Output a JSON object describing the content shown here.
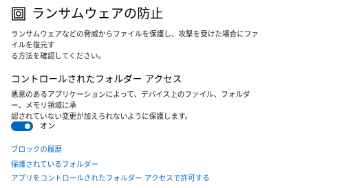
{
  "header": {
    "title": "ランサムウェアの防止",
    "icon": "ransomware-protection-icon"
  },
  "description": {
    "lines": [
      "ランサムウェアなどの脅威からファイルを保護し、攻撃を受けた場合にファイルを復元す",
      "る方法を確認してください。"
    ]
  },
  "controlled_folder_access": {
    "title": "コントロールされたフォルダー アクセス",
    "description_lines": [
      "悪意のあるアプリケーションによって、デバイス上のファイル、フォルダー、メモリ領域に承",
      "認されていない変更が加えられないように保護します。"
    ],
    "toggle": {
      "state": "on",
      "label": "オン",
      "color": "#0067c0"
    }
  },
  "links": [
    "ブロックの履歴",
    "保護されているフォルダー",
    "アプリをコントロールされたフォルダー アクセスで許可する"
  ],
  "colors": {
    "accent": "#0067c0",
    "text": "#000000",
    "background": "#ffffff"
  }
}
